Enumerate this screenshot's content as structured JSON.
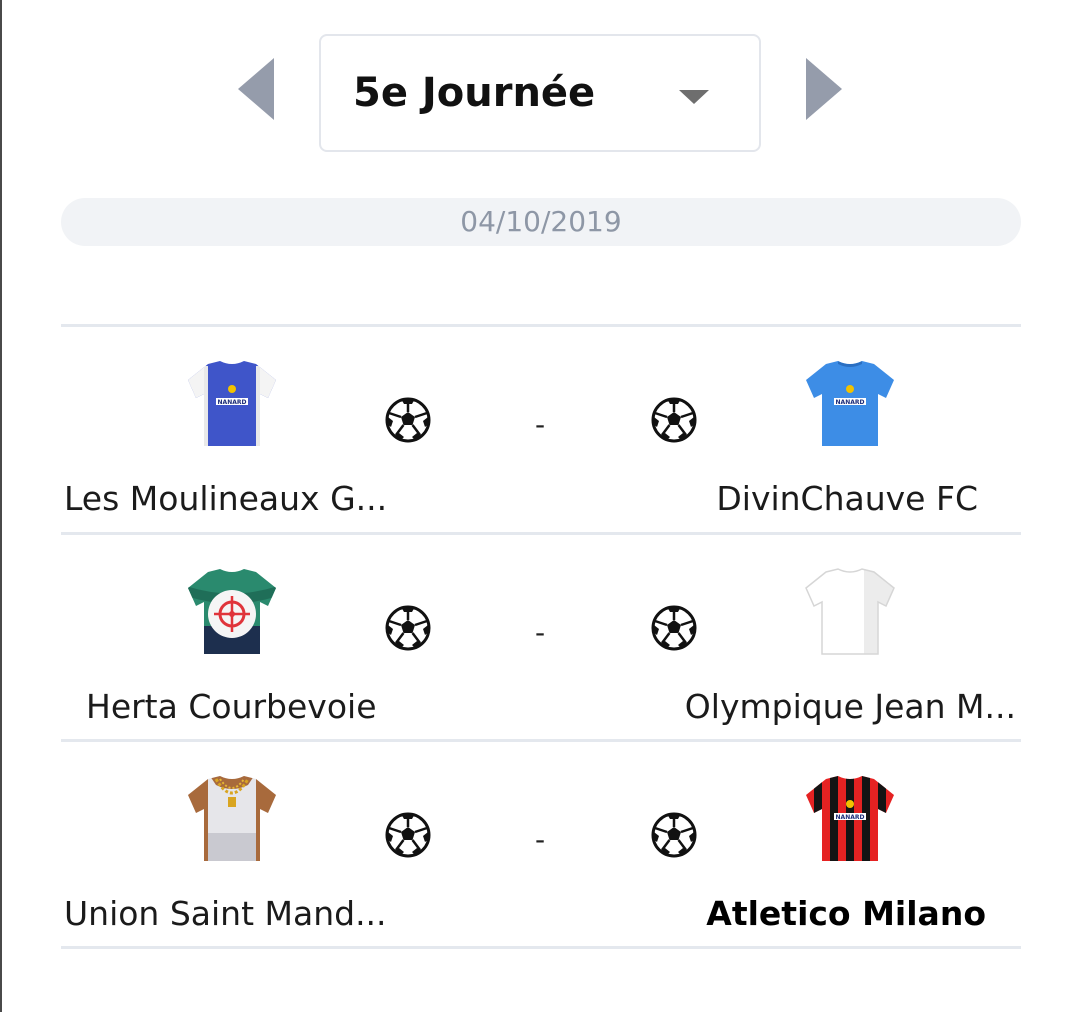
{
  "round": {
    "label": "5e Journée",
    "prev_icon": "chevron-left-icon",
    "next_icon": "chevron-right-icon"
  },
  "date": "04/10/2019",
  "colors": {
    "arrow": "#959cab",
    "date_bg": "#f1f3f6",
    "date_text": "#8e97a6",
    "divider": "#e4e8ee"
  },
  "matches": [
    {
      "home": {
        "name": "Les Moulineaux G...",
        "jersey": "jersey-blue-nanard-icon",
        "sponsor": "NANARD"
      },
      "away": {
        "name": "DivinChauve FC",
        "jersey": "jersey-light-blue-nanard-icon",
        "sponsor": "NANARD"
      },
      "separator": "-"
    },
    {
      "home": {
        "name": "Herta Courbevoie",
        "jersey": "jersey-green-target-icon"
      },
      "away": {
        "name": "Olympique Jean M...",
        "jersey": "jersey-white-icon"
      },
      "separator": "-"
    },
    {
      "home": {
        "name": "Union Saint Mand...",
        "jersey": "jersey-gold-chain-icon"
      },
      "away": {
        "name": "Atletico Milano",
        "jersey": "jersey-red-black-stripes-icon",
        "sponsor": "NANARD",
        "winner": true
      },
      "separator": "-"
    }
  ]
}
